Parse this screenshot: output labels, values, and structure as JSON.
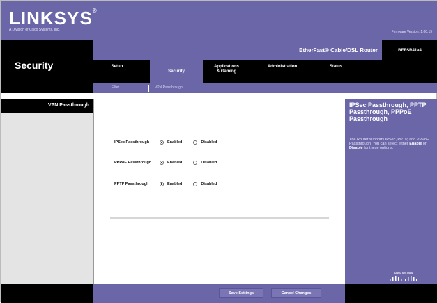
{
  "brand": {
    "logo": "LINKSYS",
    "logo_mark": "®",
    "subtitle": "A Division of Cisco Systems, Inc."
  },
  "firmware": "Firmware Version: 1.00.19",
  "product": {
    "name": "EtherFast® Cable/DSL Router",
    "model": "BEFSR41v4"
  },
  "section": "Security",
  "tabs": [
    {
      "label": "Setup",
      "active": false
    },
    {
      "label": "Security",
      "active": true
    },
    {
      "label": "Applications\n& Gaming",
      "active": false
    },
    {
      "label": "Administration",
      "active": false
    },
    {
      "label": "Status",
      "active": false
    }
  ],
  "subtabs": [
    "Filter",
    "VPN Passthrough"
  ],
  "nav_label": "VPN Passthrough",
  "settings": [
    {
      "label": "IPSec Passthrough",
      "enabled_label": "Enabled",
      "disabled_label": "Disabled",
      "value": "Enabled"
    },
    {
      "label": "PPPoE Passthrough",
      "enabled_label": "Enabled",
      "disabled_label": "Disabled",
      "value": "Enabled"
    },
    {
      "label": "PPTP Passthrough",
      "enabled_label": "Enabled",
      "disabled_label": "Disabled",
      "value": "Enabled"
    }
  ],
  "help": {
    "title": "IPSec Passthrough, PPTP Passthrough, PPPoE Passthrough",
    "text_1": "The Router supports IPSec, PPTP, and PPPoE Passthrough. You can select either ",
    "enable_word": "Enable",
    "text_2": " or ",
    "disable_word": "Disable",
    "text_3": " for these options."
  },
  "cisco_logo": "CISCO SYSTEMS",
  "buttons": {
    "save": "Save Settings",
    "cancel": "Cancel Changes"
  },
  "colors": {
    "purple": "#6b66a8",
    "black": "#000000",
    "gray": "#e4e4e4"
  }
}
